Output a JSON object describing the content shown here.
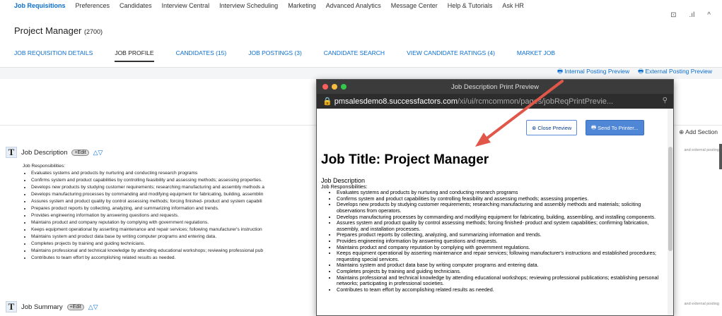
{
  "topnav": [
    "Job Requisitions",
    "Preferences",
    "Candidates",
    "Interview Central",
    "Interview Scheduling",
    "Marketing",
    "Advanced Analytics",
    "Message Center",
    "Help & Tutorials",
    "Ask HR"
  ],
  "header": {
    "title": "Project Manager",
    "req_id": "(2700)"
  },
  "tabs": [
    "JOB REQUISITION DETAILS",
    "JOB PROFILE",
    "CANDIDATES (15)",
    "JOB POSTINGS (3)",
    "CANDIDATE SEARCH",
    "VIEW CANDIDATE RATINGS (4)",
    "MARKET JOB"
  ],
  "posting_links": {
    "internal": "Internal Posting Preview",
    "external": "External Posting Preview"
  },
  "add_section": "Add Section",
  "side_note": "and external posting",
  "job_description": {
    "heading": "Job Description",
    "edit": "+Edit",
    "resp_label": "Job Responsibilities:",
    "items": [
      "Evaluates systems and products by nurturing and conducting research programs",
      "Confirms system and product capabilities by controlling feasibility and assessing methods; assessing properties.",
      "Develops new products by studying customer requirements; researching manufacturing and assembly methods a",
      "Develops manufacturing processes by commanding and modifying equipment for fabricating, building, assemblin",
      "Assures system and product quality by control assessing methods; forcing finished- product and system capabili",
      "Prepares product reports by collecting, analyzing, and summarizing information and trends.",
      "Provides engineering information by answering questions and requests.",
      "Maintains product and company reputation by complying with government regulations.",
      "Keeps equipment operational by asserting maintenance and repair services; following manufacturer's instruction",
      "Maintains system and product data base by writing computer programs and entering data.",
      "Completes projects by training and guiding technicians.",
      "Maintains professional and technical knowledge by attending educational workshops; reviewing professional pub",
      "Contributes to team effort by accomplishing related results as needed."
    ]
  },
  "job_summary": {
    "heading": "Job Summary",
    "edit": "+Edit"
  },
  "popup": {
    "window_title": "Job Description Print Preview",
    "url_host": "pmsalesdemo8.successfactors.com",
    "url_path": "/xi/ui/rcmcommon/pages/jobReqPrintPrevie...",
    "close_btn": "Close Preview",
    "send_btn": "Send To Printer...",
    "job_title": "Job Title: Project Manager",
    "desc_heading": "Job Description",
    "resp_label": "Job Responsibilities:",
    "items": [
      "Evaluates systems and products by nurturing and conducting research programs",
      "Confirms system and product capabilities by controlling feasibility and assessing methods; assessing properties.",
      "Develops new products by studying customer requirements; researching manufacturing and assembly methods and materials; soliciting observations from operators.",
      "Develops manufacturing processes by commanding and modifying equipment for fabricating, building, assembling, and installing components.",
      "Assures system and product quality by control assessing methods; forcing finished- product and system capabilities; confirming fabrication, assembly, and installation processes.",
      "Prepares product reports by collecting, analyzing, and summarizing information and trends.",
      "Provides engineering information by answering questions and requests.",
      "Maintains product and company reputation by complying with government regulations.",
      "Keeps equipment operational by asserting maintenance and repair services; following manufacturer's instructions and established procedures; requesting special services.",
      "Maintains system and product data base by writing computer programs and entering data.",
      "Completes projects by training and guiding technicians.",
      "Maintains professional and technical knowledge by attending educational workshops; reviewing professional publications; establishing personal networks; participating in professional societies.",
      "Contributes to team effort by accomplishing related results as needed."
    ]
  },
  "colors": {
    "link": "#0a6ed1",
    "arrow": "#e0574a"
  }
}
